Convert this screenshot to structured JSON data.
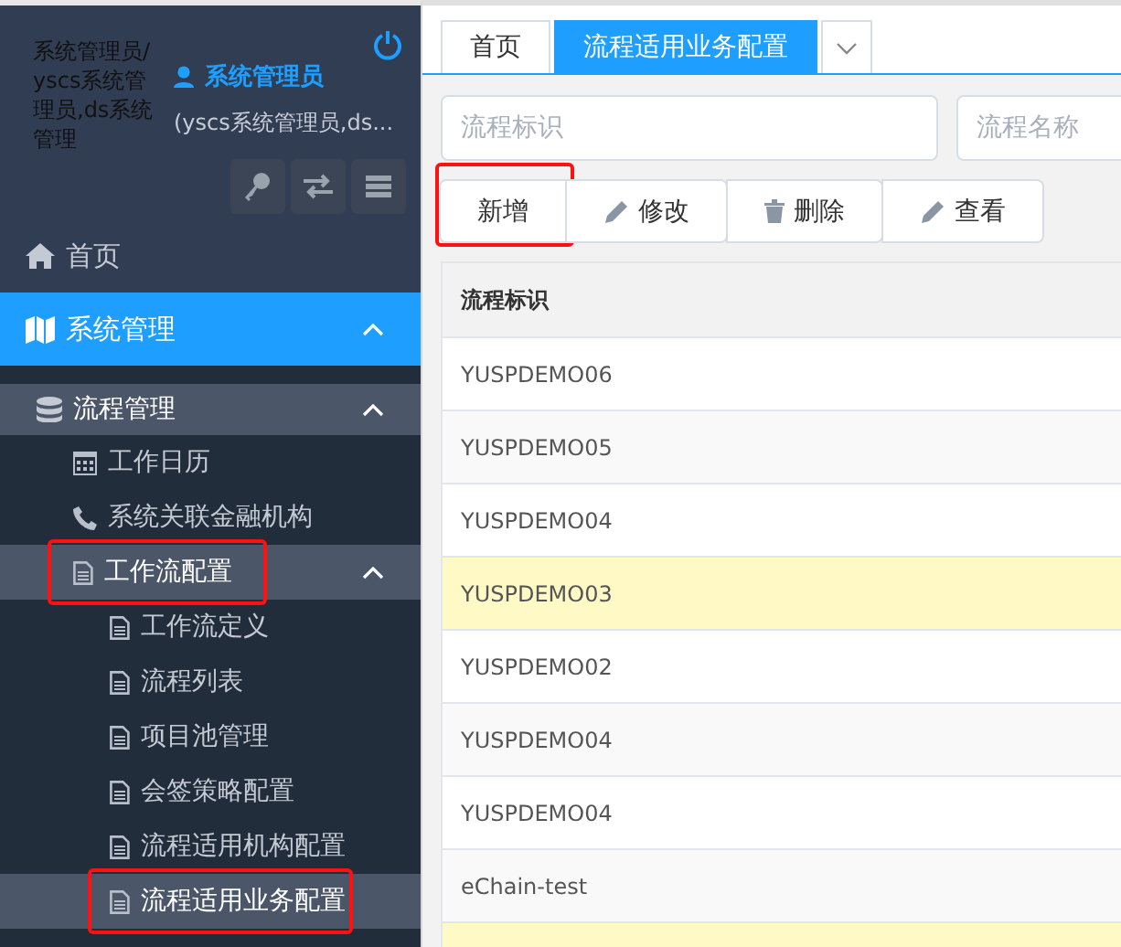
{
  "user": {
    "avatar_alt": "系统管理员/yscs系统管理员,ds系统管理",
    "name": "系统管理员",
    "roles": "(yscs系统管理员,ds..."
  },
  "nav": [
    {
      "label": "首页",
      "kind": "home",
      "expanded": false,
      "selected": false,
      "marked": false
    },
    {
      "label": "系统管理",
      "kind": "map",
      "expanded": true,
      "selected": true,
      "marked": false,
      "children": [
        {
          "label": "流程管理",
          "kind": "database",
          "expanded": true,
          "selected": false,
          "marked": false,
          "children": [
            {
              "label": "工作日历",
              "kind": "calendar",
              "selected": false,
              "marked": false
            },
            {
              "label": "系统关联金融机构",
              "kind": "phone",
              "selected": false,
              "marked": false
            },
            {
              "label": "工作流配置",
              "kind": "file",
              "expanded": true,
              "selected": false,
              "marked": true,
              "children": [
                {
                  "label": "工作流定义",
                  "kind": "file",
                  "selected": false,
                  "marked": false
                },
                {
                  "label": "流程列表",
                  "kind": "file",
                  "selected": false,
                  "marked": false
                },
                {
                  "label": "项目池管理",
                  "kind": "file",
                  "selected": false,
                  "marked": false
                },
                {
                  "label": "会签策略配置",
                  "kind": "file",
                  "selected": false,
                  "marked": false
                },
                {
                  "label": "流程适用机构配置",
                  "kind": "file",
                  "selected": false,
                  "marked": false
                },
                {
                  "label": "流程适用业务配置",
                  "kind": "file",
                  "selected": true,
                  "marked": true
                }
              ]
            }
          ]
        }
      ]
    }
  ],
  "tabs": [
    {
      "label": "首页",
      "selected": false
    },
    {
      "label": "流程适用业务配置",
      "selected": true
    }
  ],
  "search": [
    {
      "placeholder": "流程标识"
    },
    {
      "placeholder": "流程名称"
    }
  ],
  "buttons": [
    {
      "label": "新增",
      "kind": "plain",
      "marked": true
    },
    {
      "label": "修改",
      "kind": "edit",
      "marked": false
    },
    {
      "label": "删除",
      "kind": "delete",
      "marked": false
    },
    {
      "label": "查看",
      "kind": "edit",
      "marked": false
    }
  ],
  "table": {
    "columns": [
      "流程标识"
    ],
    "rows": [
      {
        "value": "YUSPDEMO06",
        "highlighted": false
      },
      {
        "value": "YUSPDEMO05",
        "highlighted": false
      },
      {
        "value": "YUSPDEMO04",
        "highlighted": false
      },
      {
        "value": "YUSPDEMO03",
        "highlighted": true
      },
      {
        "value": "YUSPDEMO02",
        "highlighted": false
      },
      {
        "value": "YUSPDEMO04",
        "highlighted": false
      },
      {
        "value": "YUSPDEMO04",
        "highlighted": false
      },
      {
        "value": "eChain-test",
        "highlighted": false
      },
      {
        "highlighted": true
      }
    ]
  }
}
